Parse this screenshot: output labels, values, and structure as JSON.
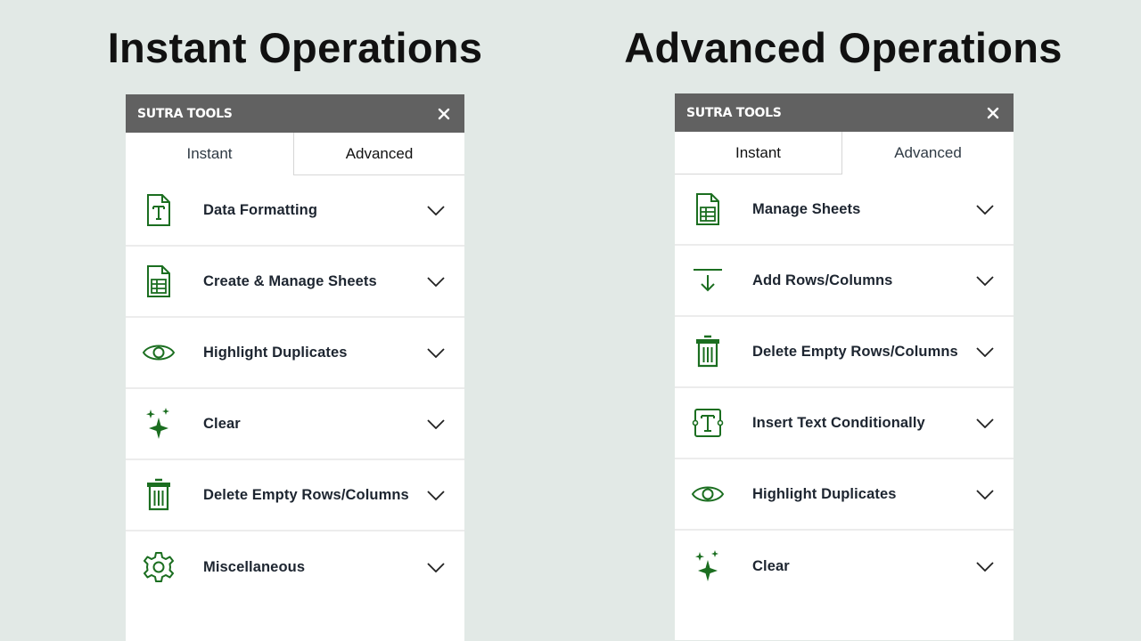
{
  "headings": {
    "left": "Instant Operations",
    "right": "Advanced Operations"
  },
  "colors": {
    "icon_green": "#1b6e20",
    "header_bg": "#616161",
    "background": "#e2e9e6"
  },
  "left_panel": {
    "title": "SUTRA TOOLS",
    "tabs": [
      {
        "label": "Instant",
        "active": true
      },
      {
        "label": "Advanced",
        "active": false
      }
    ],
    "items": [
      {
        "label": "Data Formatting",
        "icon": "text-document-icon"
      },
      {
        "label": "Create & Manage Sheets",
        "icon": "sheet-icon"
      },
      {
        "label": "Highlight Duplicates",
        "icon": "eye-icon"
      },
      {
        "label": "Clear",
        "icon": "sparkle-icon"
      },
      {
        "label": "Delete Empty Rows/Columns",
        "icon": "trash-icon"
      },
      {
        "label": "Miscellaneous",
        "icon": "gear-icon"
      }
    ]
  },
  "right_panel": {
    "title": "SUTRA TOOLS",
    "tabs": [
      {
        "label": "Instant",
        "active": false
      },
      {
        "label": "Advanced",
        "active": true
      }
    ],
    "items": [
      {
        "label": "Manage Sheets",
        "icon": "sheet-icon"
      },
      {
        "label": "Add Rows/Columns",
        "icon": "insert-row-icon"
      },
      {
        "label": "Delete Empty Rows/Columns",
        "icon": "trash-icon"
      },
      {
        "label": "Insert Text Conditionally",
        "icon": "text-box-icon"
      },
      {
        "label": "Highlight Duplicates",
        "icon": "eye-icon"
      },
      {
        "label": "Clear",
        "icon": "sparkle-icon"
      }
    ]
  }
}
